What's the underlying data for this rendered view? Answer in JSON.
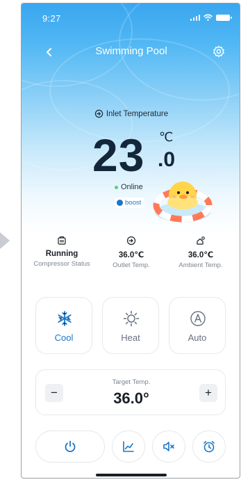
{
  "status_bar": {
    "time": "9:27"
  },
  "header": {
    "title": "Swimming Pool"
  },
  "hero": {
    "inlet_label": "Inlet Temperature",
    "temp_integer": "23",
    "temp_decimal": ".0",
    "temp_unit": "℃",
    "online_label": "Online",
    "boost_label": "boost"
  },
  "stats": [
    {
      "value": "Running",
      "label": "Compressor Status"
    },
    {
      "value": "36.0℃",
      "label": "Outlet Temp."
    },
    {
      "value": "36.0℃",
      "label": "Ambient Temp."
    }
  ],
  "modes": [
    {
      "label": "Cool",
      "icon": "snowflake-icon",
      "active": true
    },
    {
      "label": "Heat",
      "icon": "sun-icon",
      "active": false
    },
    {
      "label": "Auto",
      "icon": "auto-a-icon",
      "active": false
    }
  ],
  "target": {
    "label": "Target Temp.",
    "value": "36.0°",
    "minus": "−",
    "plus": "+"
  },
  "colors": {
    "accent": "#1c76c8",
    "hero_top": "#3aa6f0",
    "text_dark": "#14263a"
  }
}
